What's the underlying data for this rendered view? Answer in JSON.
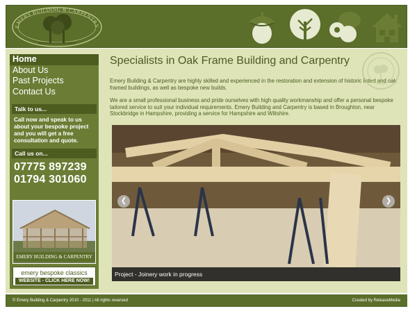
{
  "header": {
    "logo_text": "EMERY BUILDING & CARPENTRY",
    "icons": [
      "acorn-icon",
      "oak-tree-icon",
      "tools-icon",
      "house-icon"
    ]
  },
  "nav": {
    "items": [
      "Home",
      "About Us",
      "Past Projects",
      "Contact Us"
    ],
    "active": "Home"
  },
  "sidebar": {
    "talk_heading": "Talk to us...",
    "talk_text_1": "Call now and speak to us about your bespoke project and you will get a ",
    "talk_text_free": "free",
    "talk_text_2": " consultation and quote.",
    "call_heading": "Call us on...",
    "phone_1": "07775 897239",
    "phone_2": "01794 301060",
    "photo_caption": "EMERY BUILDING & CARPENTRY",
    "banner_line1": "emery bespoke classics",
    "banner_line2": "WEBSITE - CLICK HERE NOW!"
  },
  "main": {
    "title": "Specialists in Oak Frame Building and Carpentry",
    "para_1": "Emery Building & Carpentry are highly skilled and experienced in the restoration and extension of historic listed and oak framed buildings, as well as bespoke new builds.",
    "para_2": "We are a small professional business and pride ourselves with high quality workmanship and offer a personal bespoke tailored service to suit your individual requirements. Emery Building and Carpentry is based in Broughton, near Stockbridge in Hampshire, providing a service for Hampshire and Wiltshire.",
    "gallery_caption": "Project - Joinery work in progress"
  },
  "footer": {
    "left": "© Emery Building & Carpentry 2010 - 2011 | All rights reserved",
    "right": "Created by ReleaseMedia"
  },
  "colors": {
    "brand_dark": "#5b6e2a",
    "brand_mid": "#6b7d35",
    "panel": "#dfe4b8"
  }
}
